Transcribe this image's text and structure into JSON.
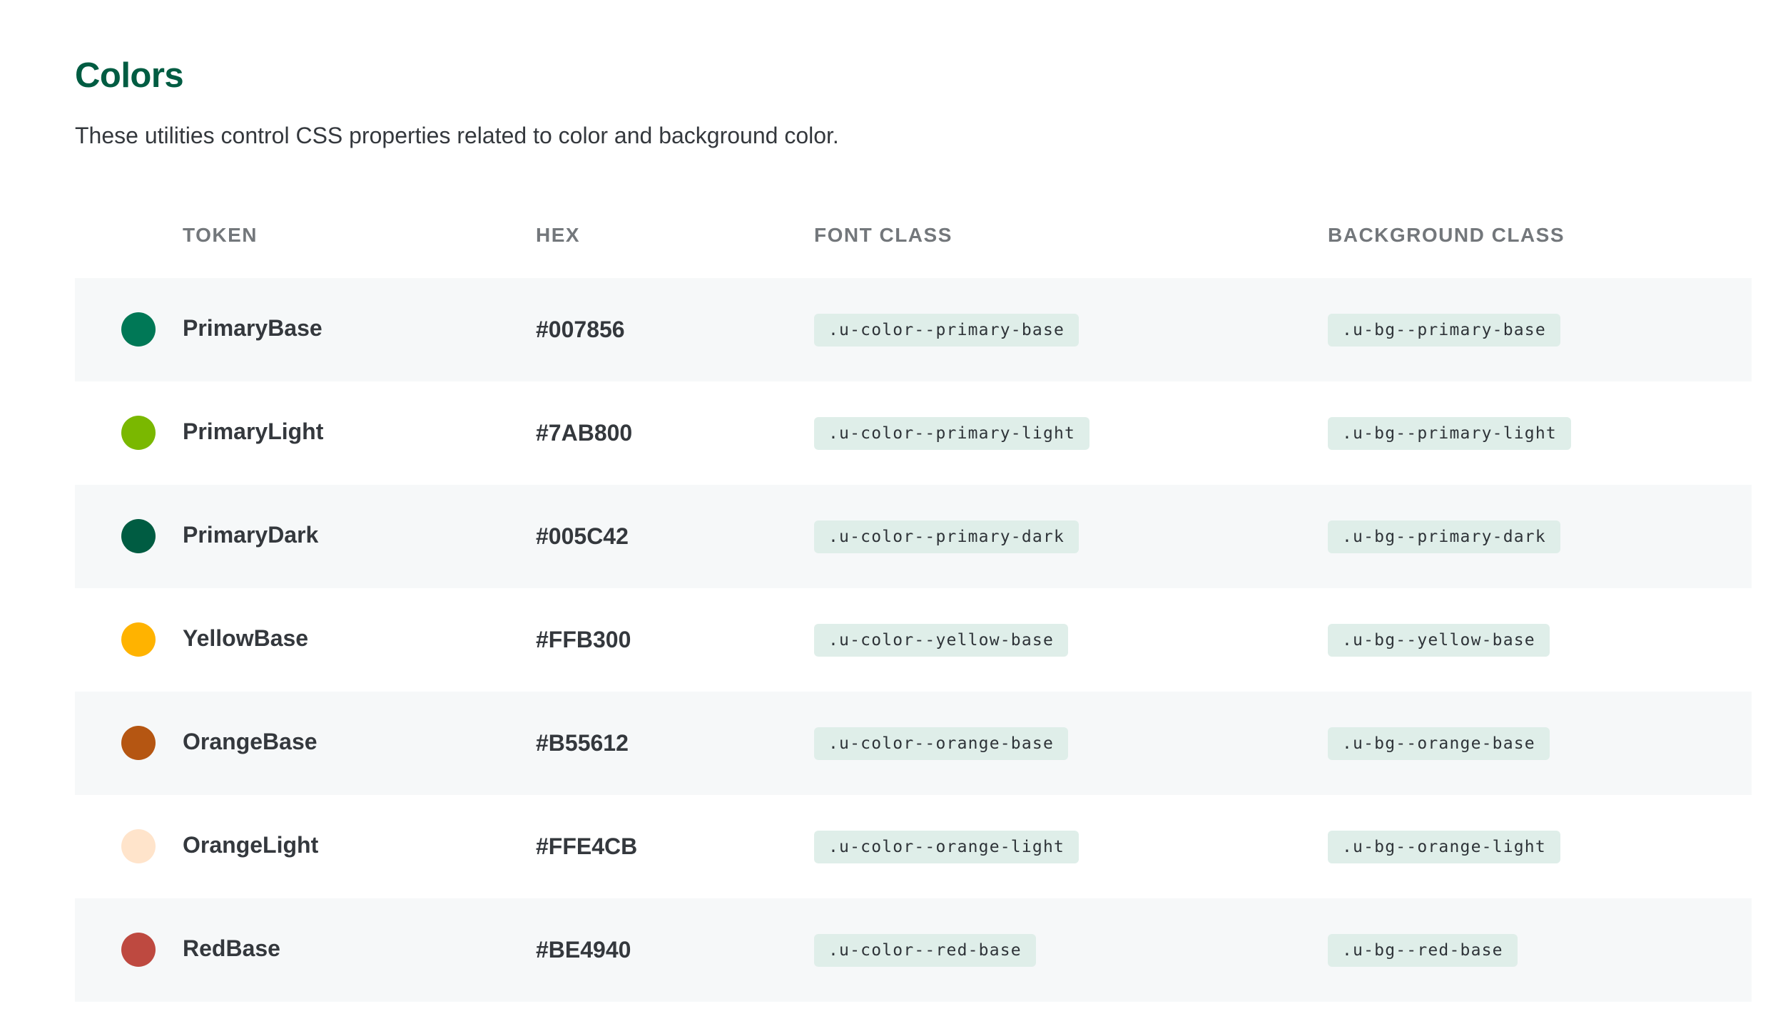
{
  "header": {
    "title": "Colors",
    "subtitle": "These utilities control CSS properties related to color and background color."
  },
  "table": {
    "columns": [
      "TOKEN",
      "HEX",
      "FONT CLASS",
      "BACKGROUND CLASS"
    ],
    "rows": [
      {
        "token": "PrimaryBase",
        "hex": "#007856",
        "font_class": ".u-color--primary-base",
        "bg_class": ".u-bg--primary-base",
        "swatch_color": "#007856"
      },
      {
        "token": "PrimaryLight",
        "hex": "#7AB800",
        "font_class": ".u-color--primary-light",
        "bg_class": ".u-bg--primary-light",
        "swatch_color": "#7AB800"
      },
      {
        "token": "PrimaryDark",
        "hex": "#005C42",
        "font_class": ".u-color--primary-dark",
        "bg_class": ".u-bg--primary-dark",
        "swatch_color": "#005C42"
      },
      {
        "token": "YellowBase",
        "hex": "#FFB300",
        "font_class": ".u-color--yellow-base",
        "bg_class": ".u-bg--yellow-base",
        "swatch_color": "#FFB300"
      },
      {
        "token": "OrangeBase",
        "hex": "#B55612",
        "font_class": ".u-color--orange-base",
        "bg_class": ".u-bg--orange-base",
        "swatch_color": "#B55612"
      },
      {
        "token": "OrangeLight",
        "hex": "#FFE4CB",
        "font_class": ".u-color--orange-light",
        "bg_class": ".u-bg--orange-light",
        "swatch_color": "#FFE4CB"
      },
      {
        "token": "RedBase",
        "hex": "#BE4940",
        "font_class": ".u-color--red-base",
        "bg_class": ".u-bg--red-base",
        "swatch_color": "#BE4940"
      }
    ]
  },
  "theme": {
    "title_color": "#005C42",
    "code_badge_background": "#DFEEE9",
    "striped_row_background": "#F6F8F9"
  }
}
